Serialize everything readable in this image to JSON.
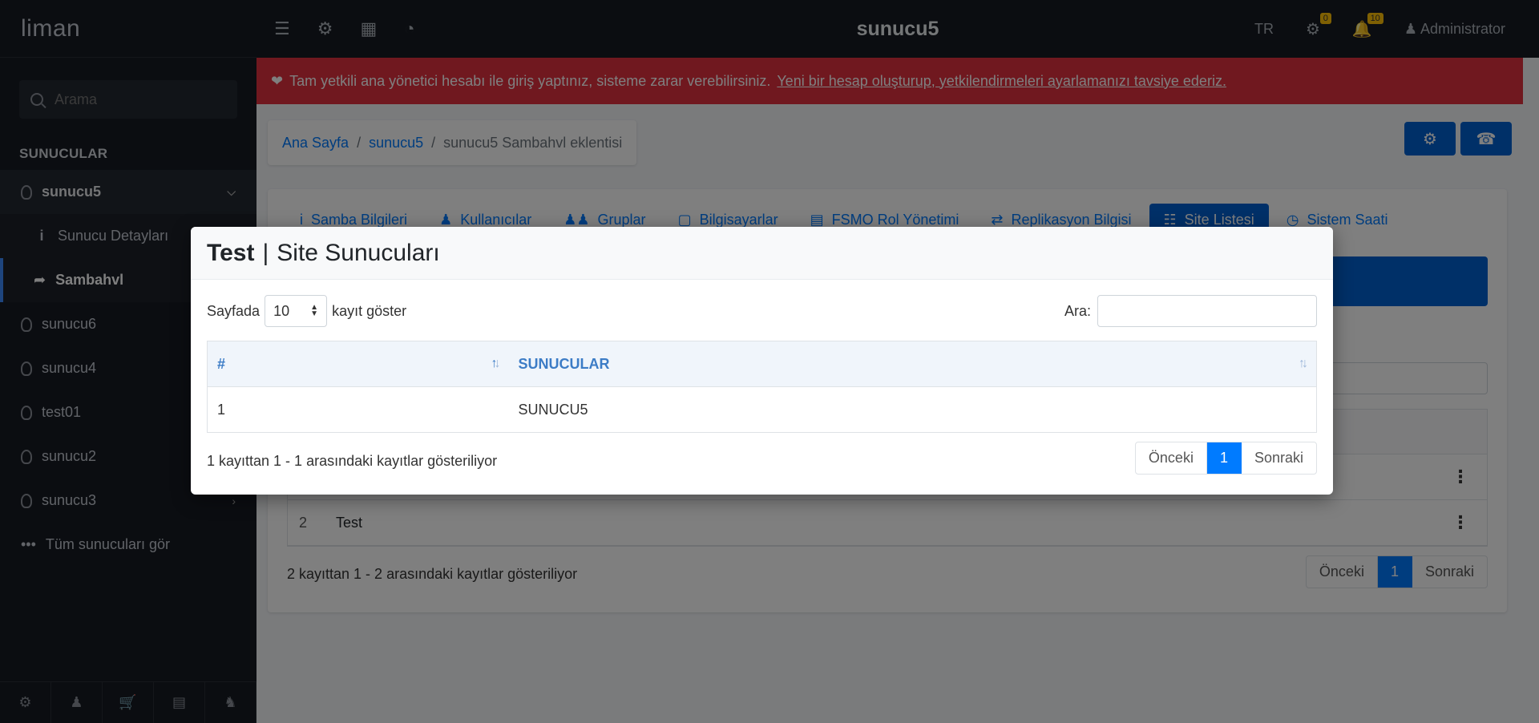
{
  "app": {
    "brand": "liman",
    "server_title": "sunucu5",
    "lang": "TR",
    "user": "Administrator",
    "badge_settings": "0",
    "badge_notif": "10"
  },
  "sidebar": {
    "search_placeholder": "Arama",
    "section": "SUNUCULAR",
    "active_server": "sunucu5",
    "sub_items": [
      "Sunucu Detayları",
      "Sambahvl"
    ],
    "servers": [
      "sunucu6",
      "sunucu4",
      "test01",
      "sunucu2",
      "sunucu3"
    ],
    "see_all": "Tüm sunucuları gör"
  },
  "alert": {
    "text": "Tam yetkili ana yönetici hesabı ile giriş yaptınız, sisteme zarar verebilirsiniz.",
    "link": "Yeni bir hesap oluşturup, yetkilendirmeleri ayarlamanızı tavsiye ederiz."
  },
  "breadcrumb": {
    "home": "Ana Sayfa",
    "server": "sunucu5",
    "current": "sunucu5 Sambahvl eklentisi"
  },
  "tabs": [
    "Samba Bilgileri",
    "Kullanıcılar",
    "Gruplar",
    "Bilgisayarlar",
    "FSMO Rol Yönetimi",
    "Replikasyon Bilgisi",
    "Site Listesi",
    "Sistem Saati"
  ],
  "background_table": {
    "rows": [
      {
        "n": "2",
        "name": "Test"
      }
    ],
    "info": "2 kayıttan 1 - 2 arasındaki kayıtlar gösteriliyor"
  },
  "pager": {
    "prev": "Önceki",
    "page": "1",
    "next": "Sonraki"
  },
  "modal": {
    "title_bold": "Test",
    "title_rest": "Site Sunucuları",
    "show_prefix": "Sayfada",
    "page_len": "10",
    "show_suffix": "kayıt göster",
    "search_label": "Ara:",
    "columns": [
      "#",
      "SUNUCULAR"
    ],
    "rows": [
      {
        "n": "1",
        "server": "SUNUCU5"
      }
    ],
    "info": "1 kayıttan 1 - 1 arasındaki kayıtlar gösteriliyor"
  }
}
